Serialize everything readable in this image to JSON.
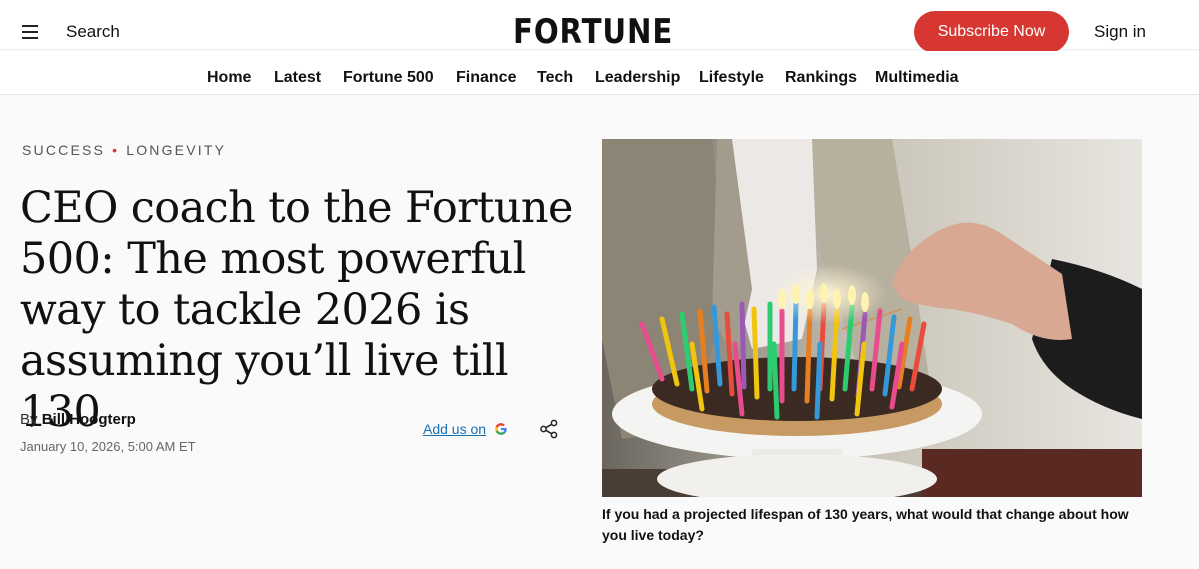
{
  "header": {
    "search_label": "Search",
    "logo_text": "FORTUNE",
    "subscribe_label": "Subscribe Now",
    "signin_label": "Sign in"
  },
  "nav": {
    "items": [
      "Home",
      "Latest",
      "Fortune 500",
      "Finance",
      "Tech",
      "Leadership",
      "Lifestyle",
      "Rankings",
      "Multimedia"
    ]
  },
  "article": {
    "kicker": [
      "SUCCESS",
      "LONGEVITY"
    ],
    "kicker_separator": "•",
    "headline": "CEO coach to the Fortune 500: The most powerful way to tackle 2026 is assuming you’ll live till 130",
    "byline_prefix": "By",
    "author": "Bill Hoogterp",
    "date": "January 10, 2026, 5:00 AM ET",
    "add_us_label": "Add us on",
    "caption": "If you had a projected lifespan of 130 years, what would that change about how you live today?"
  },
  "colors": {
    "accent": "#d63731",
    "link": "#1a6fb0"
  },
  "icons": [
    "menu-icon",
    "google-icon",
    "share-icon"
  ]
}
